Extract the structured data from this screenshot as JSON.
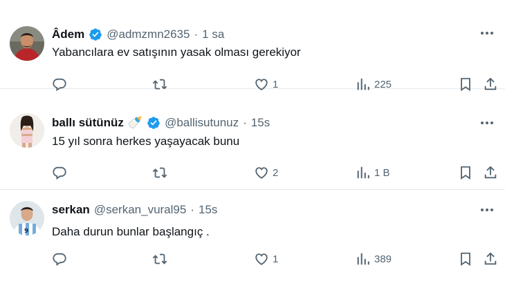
{
  "tweets": [
    {
      "name": "Âdem",
      "verified": true,
      "handle": "@admzmn2635",
      "time": "1 sa",
      "text": "Yabancılara ev satışının yasak olması gerekiyor",
      "likes": "1",
      "views": "225"
    },
    {
      "name": "ballı sütünüz",
      "emoji": "🍼",
      "verified": true,
      "handle": "@ballisutunuz",
      "time": "15s",
      "text": "15 yıl sonra herkes yaşayacak bunu",
      "likes": "2",
      "views": "1 B"
    },
    {
      "name": "serkan",
      "verified": false,
      "handle": "@serkan_vural95",
      "time": "15s",
      "text": "Daha durun bunlar başlangıç .",
      "likes": "1",
      "views": "389"
    }
  ],
  "separator": "·",
  "colors": {
    "verified": "#1d9bf0",
    "muted": "#536471",
    "text": "#0f1419"
  },
  "icons": [
    "verified-badge-icon",
    "more-icon",
    "reply-icon",
    "retweet-icon",
    "like-icon",
    "views-icon",
    "bookmark-icon",
    "share-icon"
  ]
}
